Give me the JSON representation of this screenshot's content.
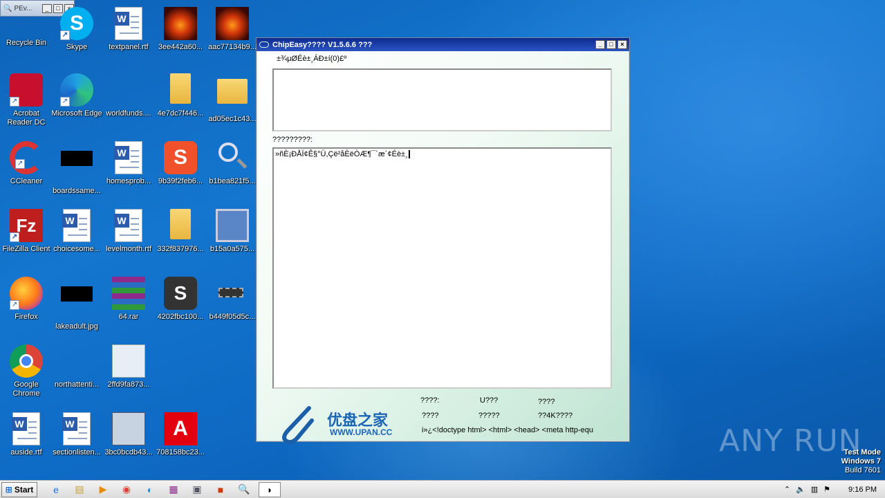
{
  "pev_window": {
    "title": "PEv..."
  },
  "desktop_icons": [
    {
      "label": "Recycle Bin"
    },
    {
      "label": "Skype"
    },
    {
      "label": "textpanel.rtf"
    },
    {
      "label": "3ee442a60..."
    },
    {
      "label": "aac77134b9..."
    },
    {
      "label": "Acrobat Reader DC"
    },
    {
      "label": "Microsoft Edge"
    },
    {
      "label": "worldfunds...."
    },
    {
      "label": "4e7dc7f446..."
    },
    {
      "label": "ad05ec1c43..."
    },
    {
      "label": "CCleaner"
    },
    {
      "label": "boardssame..."
    },
    {
      "label": "homesprob..."
    },
    {
      "label": "9b39f2feb6..."
    },
    {
      "label": "b1bea821f5..."
    },
    {
      "label": "FileZilla Client"
    },
    {
      "label": "choicesome..."
    },
    {
      "label": "levelmonth.rtf"
    },
    {
      "label": "332f837976..."
    },
    {
      "label": "b15a0a575..."
    },
    {
      "label": "Firefox"
    },
    {
      "label": "lakeadult.jpg"
    },
    {
      "label": "64.rar"
    },
    {
      "label": "4202fbc100..."
    },
    {
      "label": "b449f05d5c..."
    },
    {
      "label": "Google Chrome"
    },
    {
      "label": "northattenti..."
    },
    {
      "label": "2ffd9fa873..."
    },
    {
      "label": "auside.rtf"
    },
    {
      "label": "sectionlisten..."
    },
    {
      "label": "3bc0bcdb43..."
    },
    {
      "label": "708158bc23..."
    }
  ],
  "chipeasy": {
    "title": "ChipEasy???? V1.5.6.6 ???",
    "select_label": "±¾µØÉè±¸ÁÐ±í(0)£º",
    "info_label": "?????????:",
    "info_text": "»ñÈ¡ÐÅÏ¢Ê§°Ü,Çë²åÈëÒÆ¶¯´æ´¢Éè±¸",
    "logo_cn": "优盘之家",
    "logo_en": "WWW.UPAN.CC",
    "footer": {
      "r1c1": "????:",
      "r1c2": "U???",
      "r1c3": "????",
      "r2c1": "????",
      "r2c2": "?????",
      "r2c3": "??4K????",
      "r3": "i»¿<!doctype html> <html> <head> <meta http-equ"
    }
  },
  "watermark": {
    "text": "ANY RUN"
  },
  "testmode": {
    "line1": "Test Mode",
    "line2": "Windows 7",
    "line3": "Build 7601"
  },
  "taskbar": {
    "start_label": "Start",
    "clock": "9:16 PM"
  }
}
